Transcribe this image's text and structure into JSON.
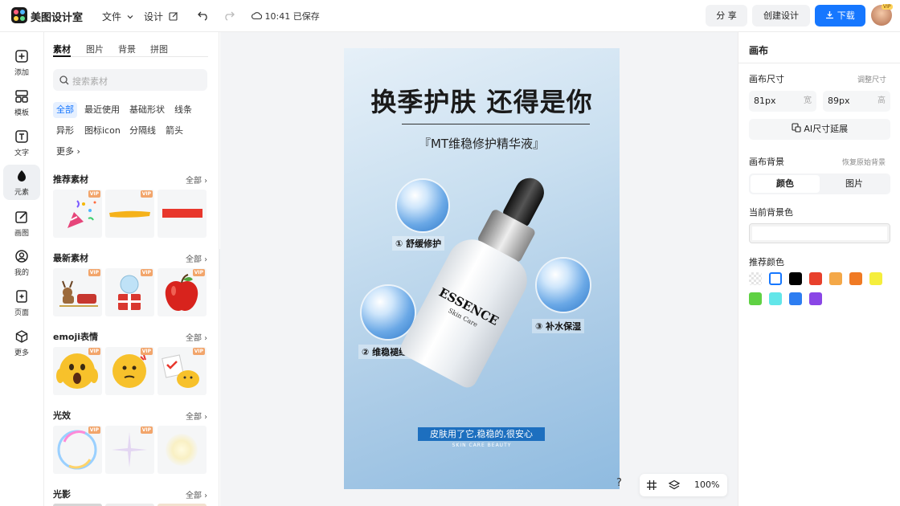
{
  "header": {
    "app_name": "美图设计室",
    "menu_file": "文件",
    "menu_design": "设计",
    "save_status": "10:41 已保存",
    "share_label": "分 享",
    "create_label": "创建设计",
    "download_label": "下载",
    "vip_badge": "VIP"
  },
  "iconbar": {
    "items": [
      {
        "label": "添加",
        "icon": "plus-square-icon"
      },
      {
        "label": "模板",
        "icon": "template-icon"
      },
      {
        "label": "文字",
        "icon": "text-icon"
      },
      {
        "label": "元素",
        "icon": "elements-icon"
      },
      {
        "label": "画图",
        "icon": "draw-icon"
      },
      {
        "label": "我的",
        "icon": "user-icon"
      },
      {
        "label": "页面",
        "icon": "page-icon"
      },
      {
        "label": "更多",
        "icon": "cube-icon"
      }
    ],
    "active": "元素"
  },
  "panel": {
    "tabs": [
      "素材",
      "图片",
      "背景",
      "拼图"
    ],
    "active_tab": "素材",
    "search_placeholder": "搜索素材",
    "chips": [
      "全部",
      "最近使用",
      "基础形状",
      "线条",
      "异形",
      "图标icon",
      "分隔线",
      "箭头",
      "更多"
    ],
    "active_chip": "全部",
    "all_label": "全部",
    "vip": "VIP",
    "sections": [
      {
        "title": "推荐素材"
      },
      {
        "title": "最新素材"
      },
      {
        "title": "emoji表情"
      },
      {
        "title": "光效"
      },
      {
        "title": "光影"
      }
    ]
  },
  "canvas": {
    "title": "换季护肤 还得是你",
    "subtitle": "『MT维稳修护精华液』",
    "bubble1_label": "① 舒缓修护",
    "bubble2_label": "② 维稳褪红",
    "bubble3_label": "③ 补水保湿",
    "bottle_brand": "ESSENCE",
    "bottle_tag": "Skin Care",
    "banner": "皮肤用了它,稳稳的,很安心",
    "small_text": "SKIN CARE BEAUTY"
  },
  "zoom": {
    "help": "?",
    "value": "100%"
  },
  "right_panel": {
    "title": "画布",
    "size_label": "画布尺寸",
    "adjust_link": "调整尺寸",
    "width_value": "81px",
    "width_unit": "宽",
    "height_value": "89px",
    "height_unit": "高",
    "ai_extend": "AI尺寸延展",
    "bg_label": "画布背景",
    "restore_link": "恢复原始背景",
    "seg_color": "颜色",
    "seg_image": "图片",
    "current_bg_label": "当前背景色",
    "recommend_label": "推荐颜色",
    "swatches": [
      "transparent",
      "#ffffff",
      "#000000",
      "#e8402c",
      "#f4a848",
      "#f07a24",
      "#f5ee3c",
      "#5fd143",
      "#62e6e9",
      "#2d7df1",
      "#8a46e6"
    ]
  },
  "colors": {
    "accent": "#1677ff",
    "banner": "#1d6fbf"
  }
}
